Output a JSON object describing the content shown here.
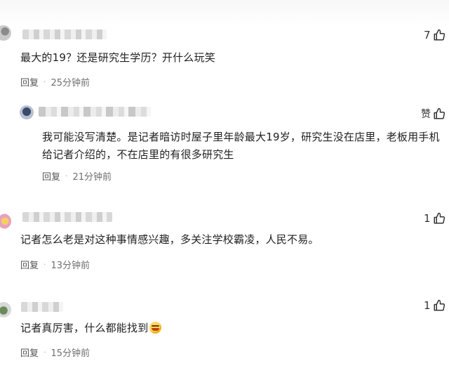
{
  "comments": [
    {
      "text": "最大的19？还是研究生学历？开什么玩笑",
      "reply_label": "回复",
      "time": "25分钟前",
      "likes": "7"
    },
    {
      "text_line1": "我可能没写清楚。是记者暗访时屋子里年龄最大19岁，研究生没在店里，老板用手机",
      "text_line2": "给记者介绍的，不在店里的有很多研究生",
      "reply_label": "回复",
      "time": "21分钟前",
      "likes": "赞"
    },
    {
      "text": "记者怎么老是对这种事情感兴趣，多关注学校霸凌，人民不易。",
      "reply_label": "回复",
      "time": "13分钟前",
      "likes": "1"
    },
    {
      "text": "记者真厉害，什么都能找到",
      "emoji": "grinning-squint-emoji",
      "reply_label": "回复",
      "time": "15分钟前",
      "likes": "1"
    }
  ],
  "separator": "·",
  "icons": {
    "like": "thumbs-up-icon"
  },
  "colors": {
    "text": "#1f1f1f",
    "meta": "#6f6f6f",
    "background": "#ffffff"
  }
}
